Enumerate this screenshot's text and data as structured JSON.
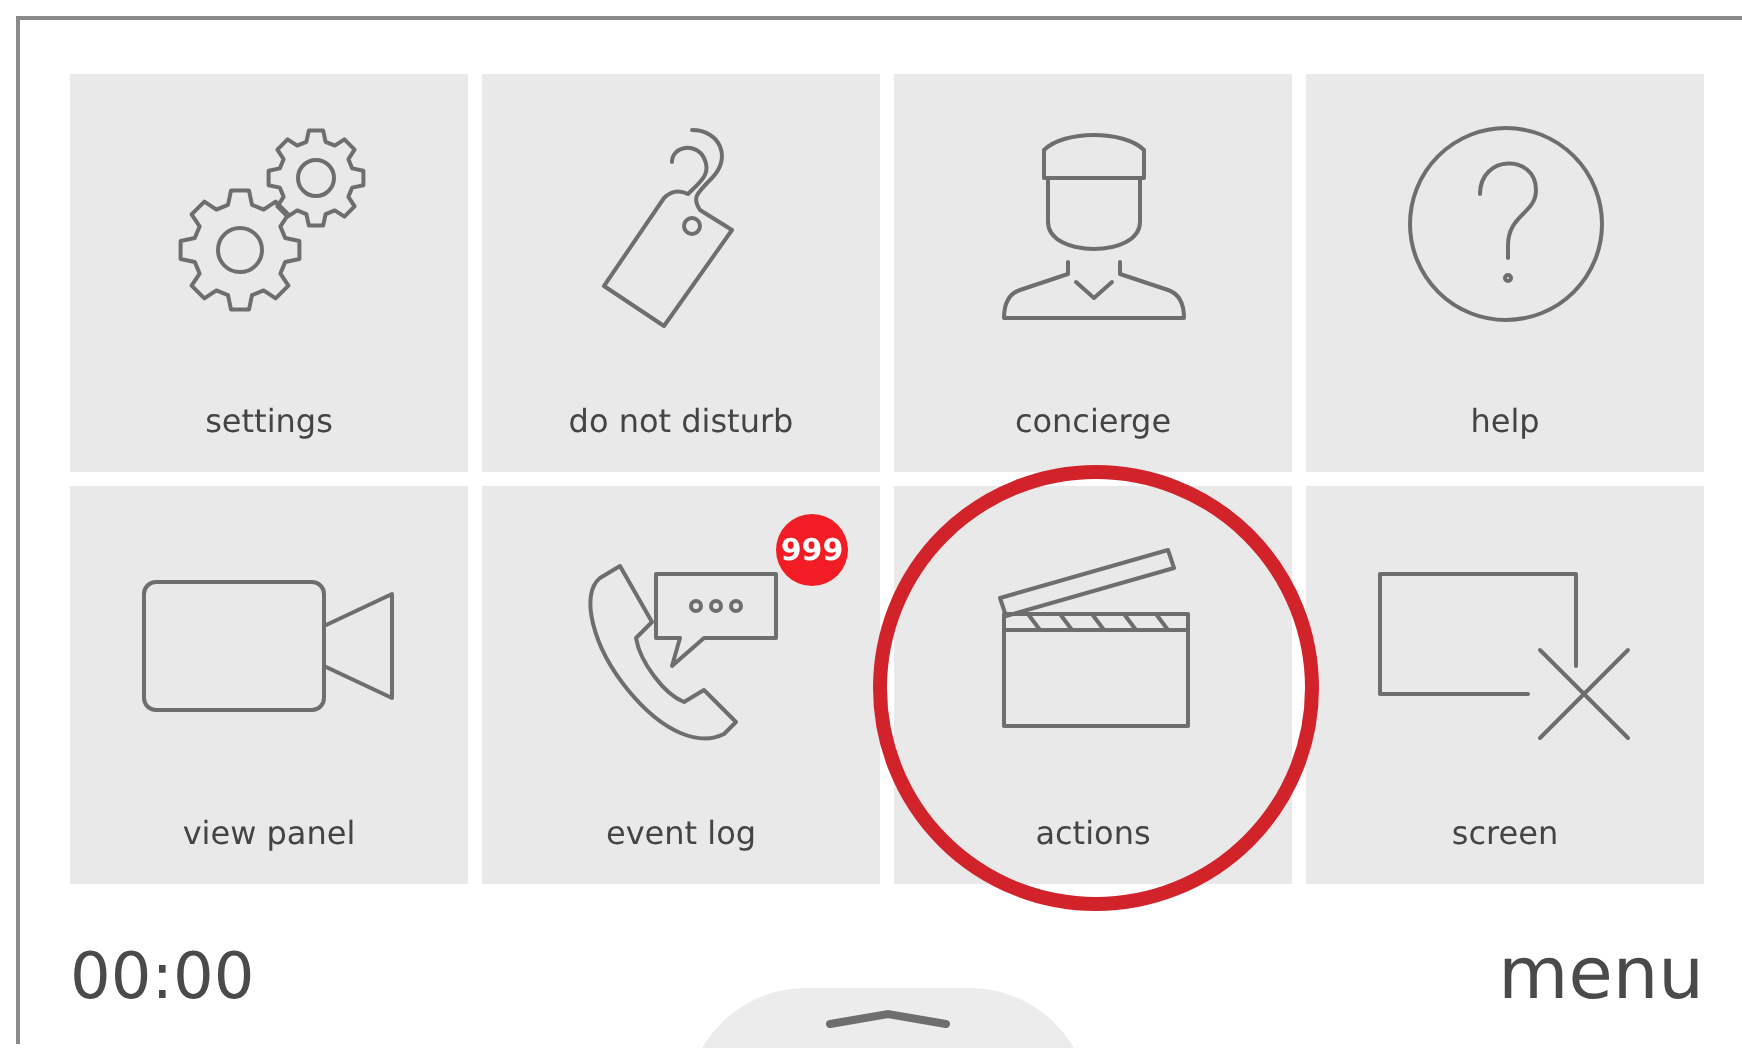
{
  "tiles": [
    {
      "label": "settings",
      "highlighted": false
    },
    {
      "label": "do not disturb",
      "highlighted": false
    },
    {
      "label": "concierge",
      "highlighted": false
    },
    {
      "label": "help",
      "highlighted": false
    },
    {
      "label": "view panel",
      "highlighted": false
    },
    {
      "label": "event log",
      "highlighted": false,
      "badge": "999"
    },
    {
      "label": "actions",
      "highlighted": true
    },
    {
      "label": "screen",
      "highlighted": false
    }
  ],
  "footer": {
    "time": "00:00",
    "menu": "menu"
  }
}
